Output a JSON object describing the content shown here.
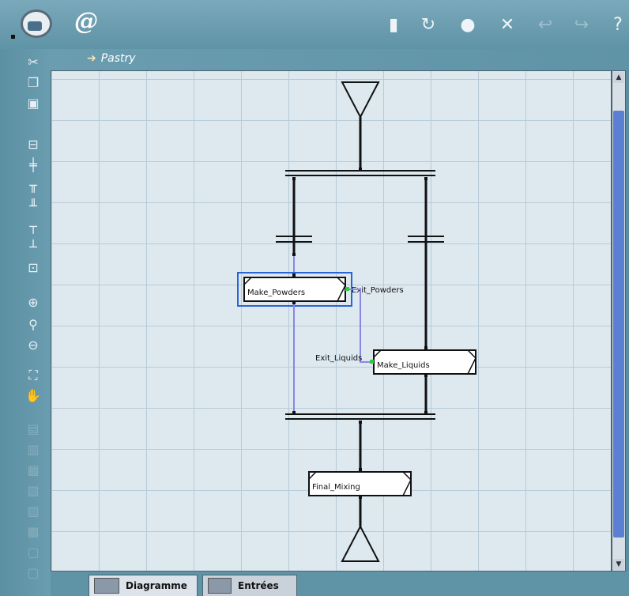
{
  "header": {
    "at_symbol": "@"
  },
  "diagram": {
    "title": "Pastry",
    "blocks": {
      "make_powders": "Make_Powders",
      "make_liquids": "Make_Liquids",
      "final_mixing": "Final_Mixing"
    },
    "ports": {
      "exit_powders": "Exit_Powders",
      "exit_liquids": "Exit_Liquids"
    }
  },
  "tabs": {
    "diagram": "Diagramme",
    "entries": "Entrées"
  },
  "colors": {
    "accent": "#2b64d6",
    "canvas": "#dde8ef",
    "chrome": "#5f93a6"
  }
}
